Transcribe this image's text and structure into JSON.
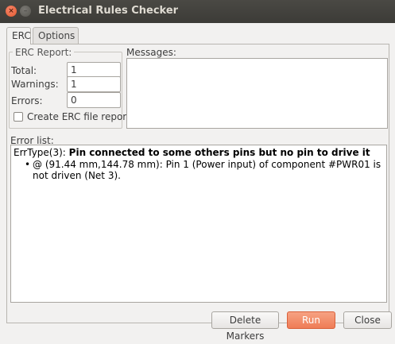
{
  "window": {
    "title": "Electrical Rules Checker",
    "close_glyph": "×",
    "minimize_glyph": "–"
  },
  "tabs": [
    {
      "label": "ERC",
      "active": true
    },
    {
      "label": "Options",
      "active": false
    }
  ],
  "erc_report": {
    "title": "ERC Report:",
    "total_label": "Total:",
    "total_value": "1",
    "warnings_label": "Warnings:",
    "warnings_value": "1",
    "errors_label": "Errors:",
    "errors_value": "0",
    "create_report_label": "Create ERC file report",
    "create_report_checked": false
  },
  "messages": {
    "label": "Messages:",
    "content": ""
  },
  "error_list": {
    "label": "Error list:",
    "error_type_prefix": "ErrType(3): ",
    "error_type_text": "Pin connected to some others pins but no pin to drive it",
    "bullet": "•",
    "item_text": "@ (91.44 mm,144.78 mm): Pin 1 (Power input) of component #PWR01 is not driven (Net 3)."
  },
  "buttons": {
    "delete_markers": "Delete Markers",
    "run": "Run",
    "close": "Close"
  },
  "colors": {
    "titlebar": "#3c3b37",
    "run_button": "#ef7c56",
    "window_bg": "#f2f1f0"
  }
}
